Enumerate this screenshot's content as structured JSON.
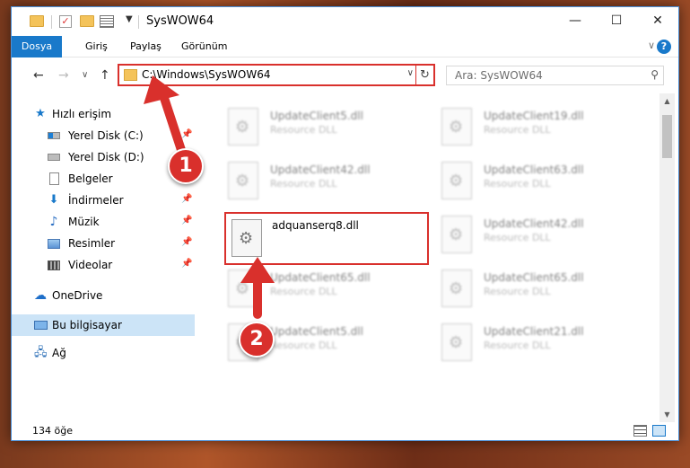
{
  "window": {
    "title": "SysWOW64",
    "controls": {
      "minimize": "—",
      "maximize": "☐",
      "close": "✕"
    }
  },
  "ribbon": {
    "tabs": [
      "Dosya",
      "Giriş",
      "Paylaş",
      "Görünüm"
    ],
    "collapse_glyph": "∨",
    "help_glyph": "?"
  },
  "nav": {
    "back_glyph": "←",
    "forward_glyph": "→",
    "recent_glyph": "∨",
    "up_glyph": "↑",
    "address": "C:\\Windows\\SysWOW64",
    "address_dropdown_glyph": "∨",
    "refresh_glyph": "↻",
    "search_placeholder": "Ara: SysWOW64",
    "search_glyph": "⚲"
  },
  "sidebar": {
    "quick_access": "Hızlı erişim",
    "items": [
      {
        "label": "Yerel Disk (C:)",
        "pinned": true
      },
      {
        "label": "Yerel Disk (D:)",
        "pinned": false
      },
      {
        "label": "Belgeler",
        "pinned": true
      },
      {
        "label": "İndirmeler",
        "pinned": true
      },
      {
        "label": "Müzik",
        "pinned": true
      },
      {
        "label": "Resimler",
        "pinned": true
      },
      {
        "label": "Videolar",
        "pinned": true
      }
    ],
    "onedrive": "OneDrive",
    "this_pc": "Bu bilgisayar",
    "network": "Ağ"
  },
  "files": {
    "highlighted": {
      "name": "adquanserq8.dll"
    },
    "blurred": [
      {
        "name": "UpdateClient5.dll",
        "type": "Resource DLL"
      },
      {
        "name": "UpdateClient19.dll",
        "type": "Resource DLL"
      },
      {
        "name": "UpdateClient42.dll",
        "type": "Resource DLL"
      },
      {
        "name": "UpdateClient63.dll",
        "type": "Resource DLL"
      },
      {
        "name": "UpdateClient42.dll",
        "type": "Resource DLL"
      },
      {
        "name": "UpdateClient65.dll",
        "type": "Resource DLL"
      },
      {
        "name": "UpdateClient65.dll",
        "type": "Resource DLL"
      },
      {
        "name": "UpdateClient5.dll",
        "type": "Resource DLL"
      },
      {
        "name": "UpdateClient21.dll",
        "type": "Resource DLL"
      }
    ]
  },
  "status": {
    "item_count": "134 öğe"
  },
  "annotations": {
    "step1": "1",
    "step2": "2",
    "accent_color": "#d9302c"
  }
}
